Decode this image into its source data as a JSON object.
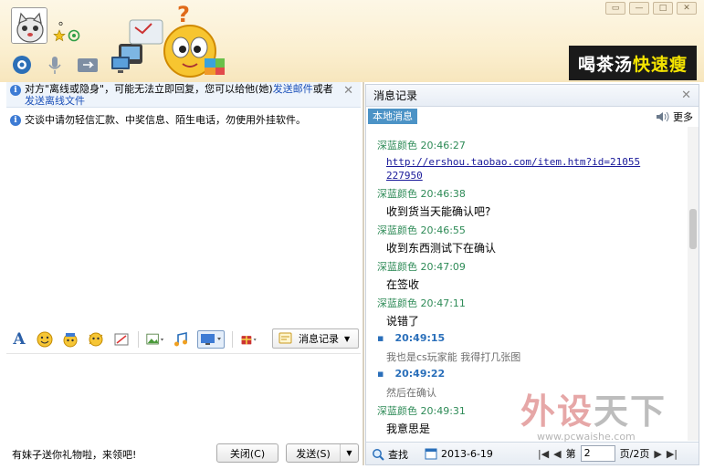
{
  "header": {
    "nickname": "。",
    "ad": {
      "part1": "喝茶汤",
      "part2": "快速瘦"
    },
    "window_controls": [
      "restore-icon",
      "minimize-icon",
      "maximize-icon",
      "close-icon"
    ]
  },
  "left": {
    "offline_notice": {
      "text1": "对方\"离线或隐身\"，可能无法立即回复，您可以给他(她)",
      "link1": "发送邮件",
      "text2": "或者",
      "link2": "发送离线文件"
    },
    "security_tip": "交谈中请勿轻信汇款、中奖信息、陌生电话，勿使用外挂软件。",
    "history_button": "消息记录",
    "gift_text": "有妹子送你礼物啦，来领吧!",
    "close_button": "关闭(C)",
    "send_button": "发送(S)"
  },
  "history": {
    "title": "消息记录",
    "local_tab": "本地消息",
    "more": "更多",
    "messages": [
      {
        "head": "深蓝颜色 20:46:27",
        "body": "http://ershou.taobao.com/item.htm?id=21055",
        "body2": "227950"
      },
      {
        "head": "深蓝颜色 20:46:38",
        "body": "收到货当天能确认吧?"
      },
      {
        "head": "深蓝颜色 20:46:55",
        "body": "收到东西测试下在确认"
      },
      {
        "head": "深蓝颜色 20:47:09",
        "body": "在签收"
      },
      {
        "head": "深蓝颜色 20:47:11",
        "body": "说错了"
      },
      {
        "head": "20:49:15",
        "body": "我也是cs玩家能 我得打几张图"
      },
      {
        "head": "20:49:22",
        "body": "然后在确认"
      },
      {
        "head": "深蓝颜色 20:49:31",
        "body": "我意思是"
      }
    ],
    "footer": {
      "find": "查找",
      "date": "2013-6-19",
      "page_prefix": "第",
      "page_value": "2",
      "page_suffix": "页/2页"
    }
  },
  "watermark": {
    "main1": "外设",
    "main2": "天下",
    "url": "www.pcwaishe.com"
  }
}
